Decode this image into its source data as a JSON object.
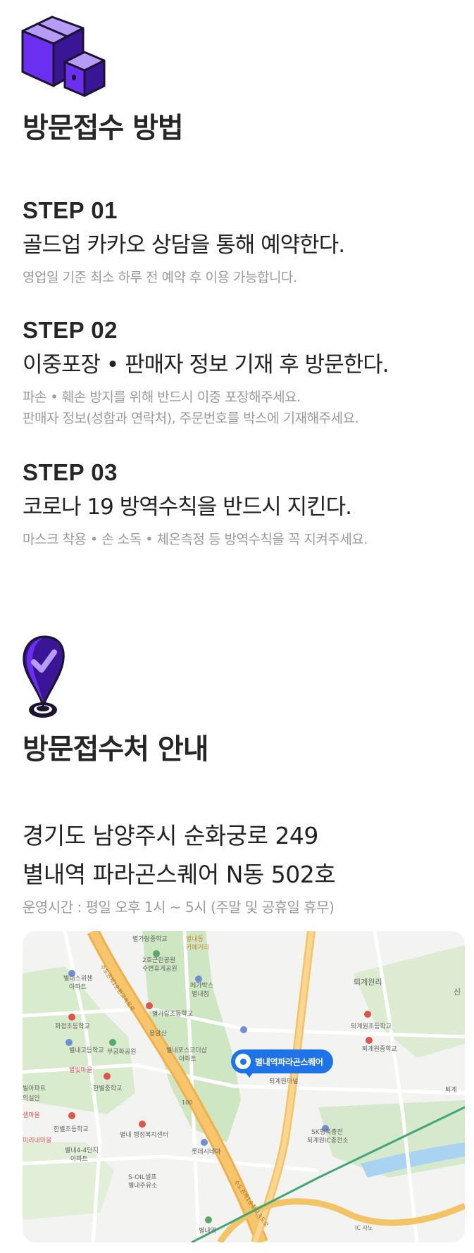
{
  "section1": {
    "icon": "boxes-icon",
    "title": "방문접수 방법",
    "steps": [
      {
        "label": "STEP 01",
        "title": "골드업 카카오 상담을 통해 예약한다.",
        "desc": [
          "영업일 기준 최소 하루 전 예약 후 이용 가능합니다."
        ]
      },
      {
        "label": "STEP 02",
        "title": "이중포장 • 판매자 정보 기재 후 방문한다.",
        "desc": [
          "파손 • 훼손 방지를 위해 반드시 이중 포장해주세요.",
          "판매자 정보(성함과 연락처), 주문번호를 박스에 기재해주세요."
        ]
      },
      {
        "label": "STEP 03",
        "title": "코로나 19 방역수칙을 반드시 지킨다.",
        "desc": [
          "마스크 착용 • 손 소독 • 체온측정 등 방역수칙을 꼭 지켜주세요."
        ]
      }
    ]
  },
  "section2": {
    "icon": "location-check-icon",
    "title": "방문접수처 안내",
    "address_line1": "경기도 남양주시 순화궁로 249",
    "address_line2": "별내역 파라곤스퀘어 N동 502호",
    "hours": "운영시간 : 평일 오후 1시 ~ 5시 (주말 및 공휴일 휴무)"
  },
  "map": {
    "pin_label": "별내역파라곤스퀘어",
    "labels": {
      "l1": "별가람중학교",
      "l2": "별내동",
      "l3": "카페거리",
      "l4": "2호근린공원",
      "l5": "수변휴게공원",
      "l6": "별내스위첸",
      "l7": "아파트",
      "l8": "메가박스",
      "l9": "별내점",
      "l10": "퇴계원리",
      "l11": "별가람초등학교",
      "l12": "화접초등학교",
      "l13": "용암산",
      "l14": "퇴계원초등학교",
      "l15": "퇴계원중학교",
      "l16": "별내고등학교",
      "l17": "무궁화공원",
      "l18": "별내포스코더샵",
      "l19": "아파트",
      "l20": "별빛마을",
      "l21": "퇴계원터널",
      "l22": "빌아파트",
      "l23": "의실안",
      "l24": "한별중학교",
      "l25": "샘마을",
      "l26": "한별초등학교",
      "l27": "별내 행정복지센터",
      "l28": "SK행복충전",
      "l29": "퇴계원IC충전소",
      "l30": "미리내마을",
      "l31": "별내4-4단지",
      "l32": "아파트",
      "l33": "롯데시네마",
      "l34": "S-OIL셀프",
      "l35": "별내주유소",
      "l36": "별내역",
      "l37": "IC 사노",
      "l38": "퇴계",
      "l39": "신",
      "l40": "수도권제1순환고속도로",
      "l41": "수도권제1순환고속도로",
      "l42": "100"
    }
  },
  "colors": {
    "accent_purple": "#5b2ee0",
    "highlight": "#e9e1fb",
    "map_pin": "#1f73e8"
  }
}
